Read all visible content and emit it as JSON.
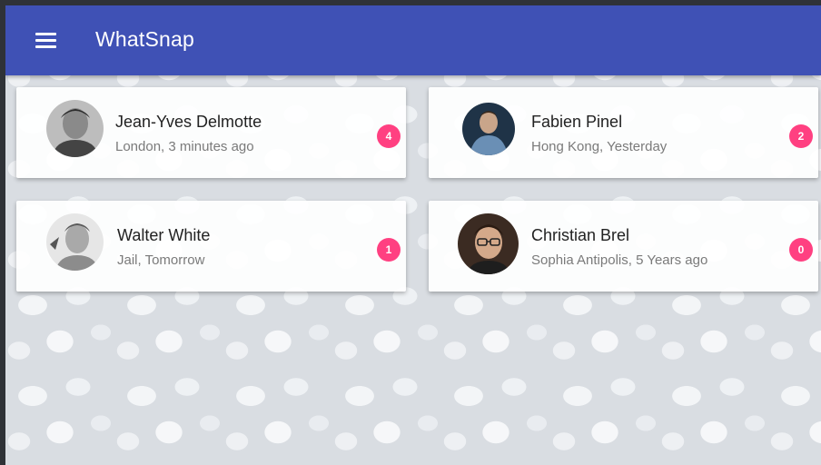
{
  "app": {
    "title": "WhatSnap",
    "accent_color": "#3f51b5",
    "badge_color": "#ff4081",
    "menu_icon": "menu-icon"
  },
  "contacts": [
    {
      "name": "Jean-Yves Delmotte",
      "subtitle": "London, 3 minutes ago",
      "badge": "4",
      "avatar_icon": "avatar-photo"
    },
    {
      "name": "Fabien Pinel",
      "subtitle": "Hong Kong, Yesterday",
      "badge": "2",
      "avatar_icon": "avatar-photo"
    },
    {
      "name": "Walter White",
      "subtitle": "Jail, Tomorrow",
      "badge": "1",
      "avatar_icon": "avatar-photo"
    },
    {
      "name": "Christian Brel",
      "subtitle": "Sophia Antipolis, 5 Years ago",
      "badge": "0",
      "avatar_icon": "avatar-photo"
    }
  ]
}
